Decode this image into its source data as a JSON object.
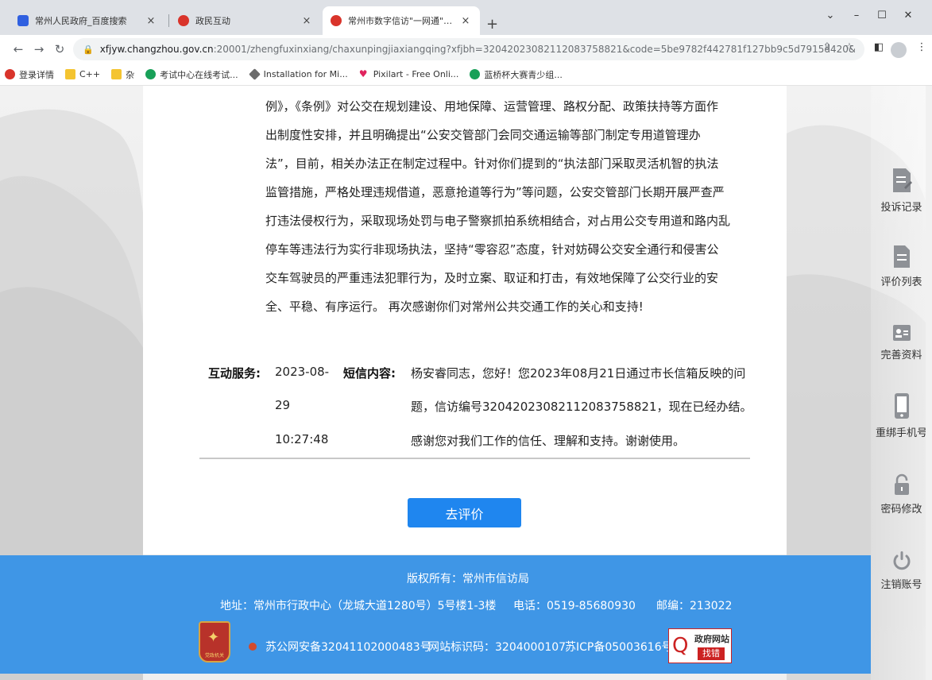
{
  "browser": {
    "tabs": [
      {
        "title": "常州人民政府_百度搜索",
        "active": false
      },
      {
        "title": "政民互动",
        "active": false
      },
      {
        "title": "常州市数字信访\"一网通\"服务平台",
        "active": true
      }
    ],
    "new_tab": "+",
    "address": {
      "host": "xfjyw.changzhou.gov.cn",
      "path": ":20001/zhengfuxinxiang/chaxunpingjiaxiangqing?xfjbh=32042023082112083758821&code=5be9782f442781f127bb9c5d7915d420&orgid..."
    },
    "bookmarks": [
      {
        "label": "登录详情",
        "icon": "baidu-icon"
      },
      {
        "label": "C++",
        "icon": "folder-icon"
      },
      {
        "label": "杂",
        "icon": "folder-icon"
      },
      {
        "label": "考试中心在线考试...",
        "icon": "exam-icon"
      },
      {
        "label": "Installation for Mi...",
        "icon": "diamond-icon"
      },
      {
        "label": "Pixilart - Free Onli...",
        "icon": "heart-icon"
      },
      {
        "label": "蓝桥杯大赛青少组...",
        "icon": "exam-icon"
      }
    ]
  },
  "reply": {
    "lines": [
      "例》，《条例》对公交在规划建设、用地保障、运营管理、路权分配、政策扶持等方面作",
      "出制度性安排，并且明确提出“公安交管部门会同交通运输等部门制定专用道管理办",
      "法”，目前，相关办法正在制定过程中。针对你们提到的“执法部门采取灵活机智的执法",
      "监管措施，严格处理违规借道，恶意抢道等行为”等问题，公安交管部门长期开展严查严",
      "打违法侵权行为，采取现场处罚与电子警察抓拍系统相结合，对占用公交专用道和路内乱",
      "停车等违法行为实行非现场执法，坚持“零容忍”态度，针对妨碍公交安全通行和侵害公",
      "交车驾驶员的严重违法犯罪行为，及时立案、取证和打击，有效地保障了公交行业的安",
      "全、平稳、有序运行。 再次感谢你们对常州公共交通工作的关心和支持!"
    ]
  },
  "interaction": {
    "service_label": "互动服务:",
    "date_lines": [
      "2023-08-",
      "29",
      "10:27:48"
    ],
    "sms_label": "短信内容:",
    "sms_lines": [
      "杨安睿同志，您好！您2023年08月21日通过市长信箱反映的问",
      "题，信访编号32042023082112083758821，现在已经办结。",
      "感谢您对我们工作的信任、理解和支持。谢谢使用。"
    ]
  },
  "evaluate_button": "去评价",
  "footer": {
    "copyright": "版权所有：常州市信访局",
    "address": "地址：常州市行政中心（龙城大道1280号）5号楼1-3楼",
    "phone": "电话：0519-85680930",
    "postcode": "邮编：213022",
    "police_record": "苏公网安备32041102000483号",
    "site_id": "网站标识码：3204000107",
    "icp": "苏ICP备05003616号",
    "emblem_text": "党政机关",
    "gov_badge_title": "政府网站",
    "gov_badge_action": "找错"
  },
  "sidebar": [
    {
      "label": "投诉记录",
      "icon": "complaint-record-icon"
    },
    {
      "label": "评价列表",
      "icon": "evaluation-list-icon"
    },
    {
      "label": "完善资料",
      "icon": "profile-card-icon"
    },
    {
      "label": "重绑手机号",
      "icon": "phone-icon"
    },
    {
      "label": "密码修改",
      "icon": "lock-icon"
    },
    {
      "label": "注销账号",
      "icon": "power-icon"
    }
  ],
  "colors": {
    "accent": "#1f86ef",
    "footer": "#3f96e6"
  }
}
